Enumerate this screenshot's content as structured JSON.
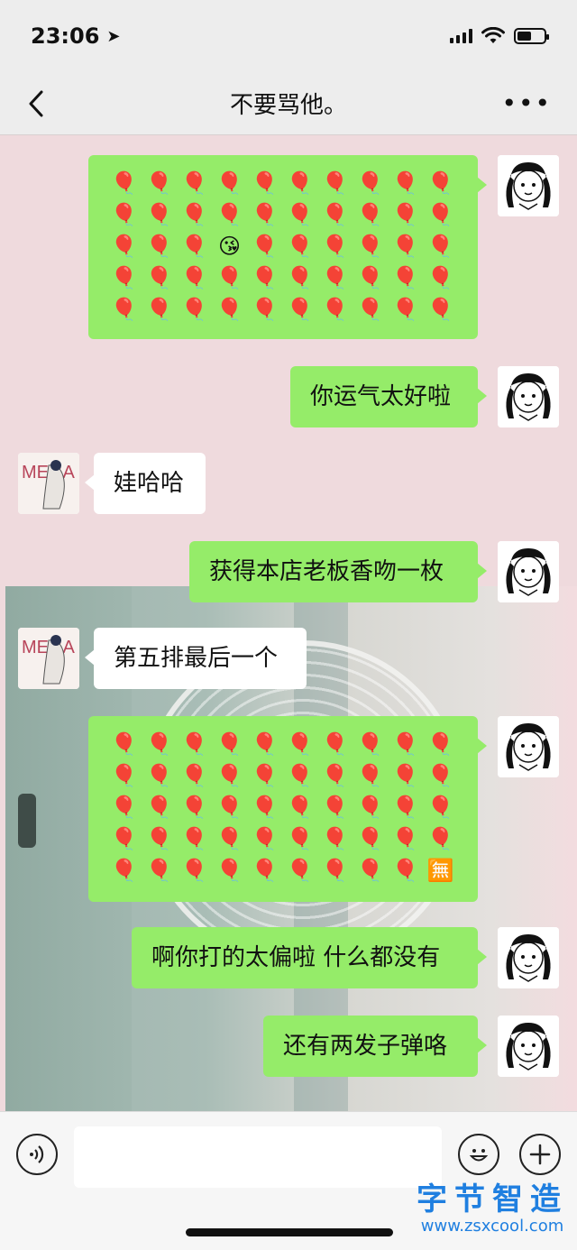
{
  "status_bar": {
    "time": "23:06",
    "location_glyph": "➤"
  },
  "nav": {
    "title": "不要骂他。",
    "more": "•••"
  },
  "messages": [
    {
      "sender": "me",
      "type": "emoji-grid",
      "rows": [
        "🎈🎈🎈🎈🎈🎈🎈🎈🎈🎈",
        "🎈🎈🎈🎈🎈🎈🎈🎈🎈🎈",
        "🎈🎈🎈😘🎈🎈🎈🎈🎈🎈",
        "🎈🎈🎈🎈🎈🎈🎈🎈🎈🎈",
        "🎈🎈🎈🎈🎈🎈🎈🎈🎈🎈"
      ]
    },
    {
      "sender": "me",
      "type": "text",
      "text": "你运气太好啦"
    },
    {
      "sender": "other",
      "type": "text",
      "text": "娃哈哈"
    },
    {
      "sender": "me",
      "type": "text",
      "text": "获得本店老板香吻一枚"
    },
    {
      "sender": "other",
      "type": "text",
      "text": "第五排最后一个"
    },
    {
      "sender": "me",
      "type": "emoji-grid",
      "rows": [
        "🎈🎈🎈🎈🎈🎈🎈🎈🎈🎈",
        "🎈🎈🎈🎈🎈🎈🎈🎈🎈🎈",
        "🎈🎈🎈🎈🎈🎈🎈🎈🎈🎈",
        "🎈🎈🎈🎈🎈🎈🎈🎈🎈🎈",
        "🎈🎈🎈🎈🎈🎈🎈🎈🎈🈚"
      ]
    },
    {
      "sender": "me",
      "type": "text",
      "text": "啊你打的太偏啦 什么都没有"
    },
    {
      "sender": "me",
      "type": "text",
      "text": "还有两发子弹咯"
    }
  ],
  "avatars": {
    "me": "girl-avatar",
    "other_text": "MEGA B"
  },
  "input_bar": {
    "placeholder": "",
    "voice_icon": "voice-icon",
    "emoji_icon": "emoji-icon",
    "plus_icon": "plus-icon"
  },
  "watermark": {
    "title": "字节智造",
    "url": "www.zsxcool.com"
  },
  "colors": {
    "my_bubble": "#95ec69",
    "other_bubble": "#ffffff",
    "chat_background": "#efdadd",
    "bar_background": "#ededed",
    "watermark": "#1f7fe0"
  }
}
